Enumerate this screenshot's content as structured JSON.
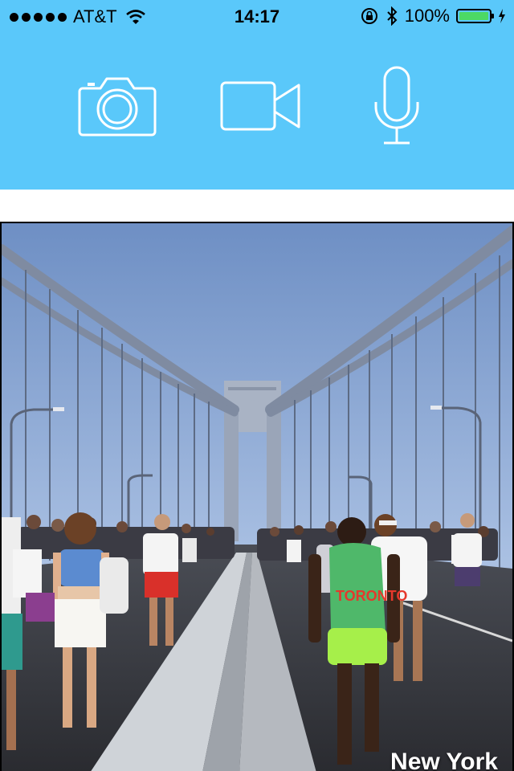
{
  "status_bar": {
    "carrier": "AT&T",
    "time": "14:17",
    "battery_percent": "100%",
    "icons": [
      "signal-dots-icon",
      "wifi-icon",
      "rotation-lock-icon",
      "bluetooth-icon",
      "battery-icon",
      "charging-icon"
    ],
    "battery_fill_fraction": 1.0
  },
  "media_toolbar": {
    "background_color": "#5ac8fa",
    "icon_color": "#ffffff",
    "buttons": [
      "camera-icon",
      "video-camera-icon",
      "microphone-icon"
    ]
  },
  "photo": {
    "subject": "bridge-marathon-photo",
    "caption": "New York"
  }
}
